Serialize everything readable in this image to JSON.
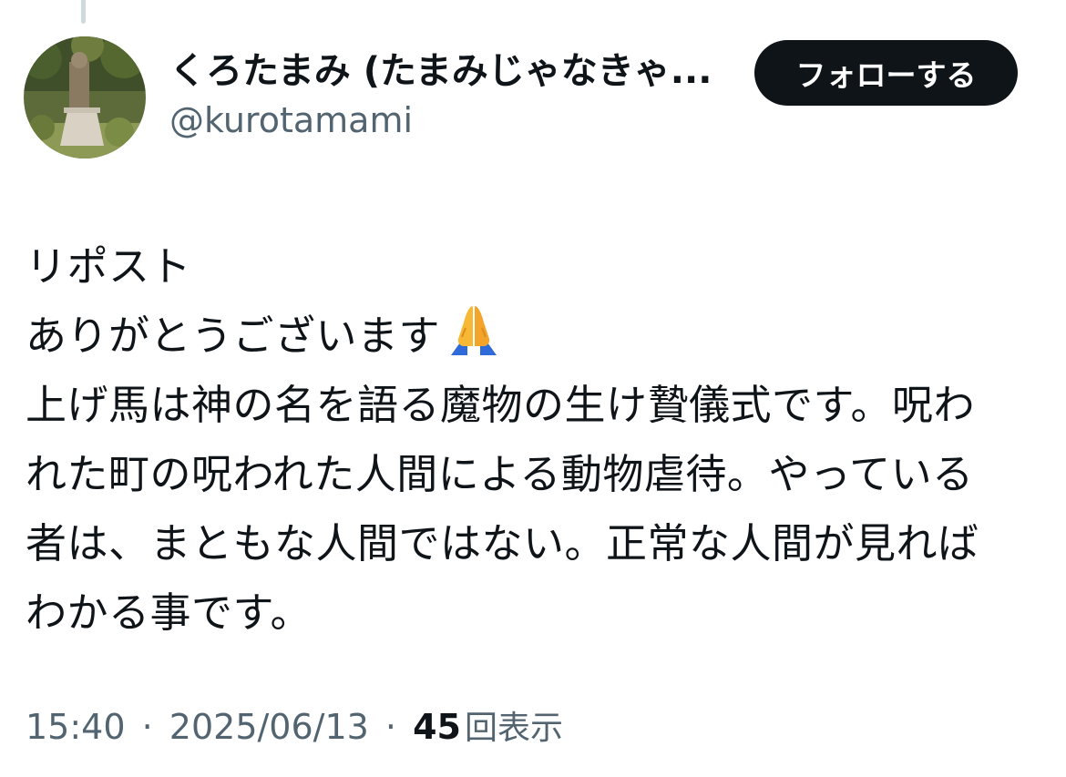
{
  "author": {
    "display_name": "くろたまみ (たまみじゃなきゃ...",
    "handle": "@kurotamami"
  },
  "follow_button": {
    "label": "フォローする"
  },
  "tweet": {
    "lines": [
      "リポスト",
      "ありがとうございます",
      "上げ馬は神の名を語る魔物の生け贄儀式です。呪わ",
      "れた町の呪われた人間による動物虐待。やっている",
      "者は、まともな人間ではない。正常な人間が見れば",
      "わかる事です。"
    ],
    "emoji": "folded-hands-icon"
  },
  "meta": {
    "time": "15:40",
    "date": "2025/06/13",
    "separator": "·",
    "views_count": "45",
    "views_label": "回表示"
  },
  "colors": {
    "text_primary": "#0f1419",
    "text_secondary": "#536471",
    "button_bg": "#0f1419",
    "button_text": "#ffffff",
    "thread_line": "#cfd9de"
  }
}
